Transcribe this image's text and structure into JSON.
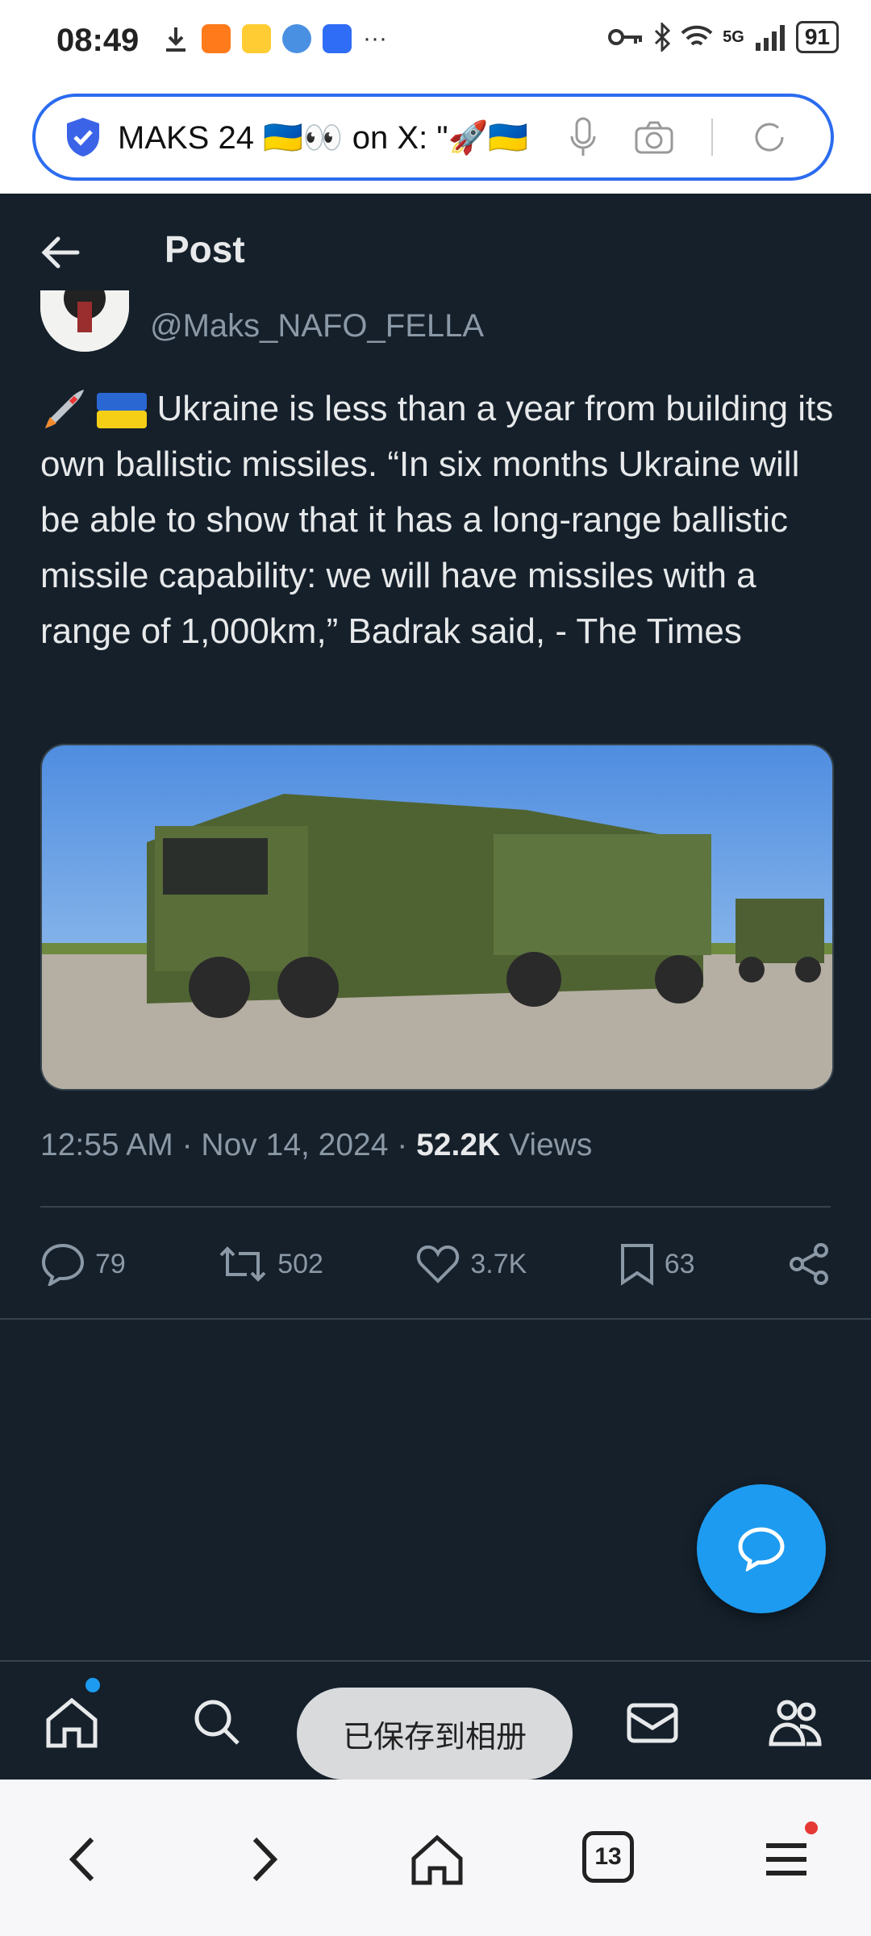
{
  "status_bar": {
    "time": "08:49",
    "network": "5G",
    "battery": "91"
  },
  "browser": {
    "url_title": "MAKS 24 🇺🇦👀 on X: \"🚀🇺🇦"
  },
  "header": {
    "title": "Post"
  },
  "post": {
    "handle": "@Maks_NAFO_FELLA",
    "text": "Ukraine is less than a year from building its own ballistic missiles. “In six months Ukraine will be able to show that it has a long-range ballistic missile capability: we will have missiles with a range of 1,000km,” Badrak said, - The Times",
    "time": "12:55 AM · Nov 14, 2024 · ",
    "views_count": "52.2K",
    "views_label": " Views",
    "stats": {
      "replies": "79",
      "reposts": "502",
      "likes": "3.7K",
      "bookmarks": "63"
    }
  },
  "toast": "已保存到相册",
  "navbar": {
    "tab_count": "13"
  }
}
